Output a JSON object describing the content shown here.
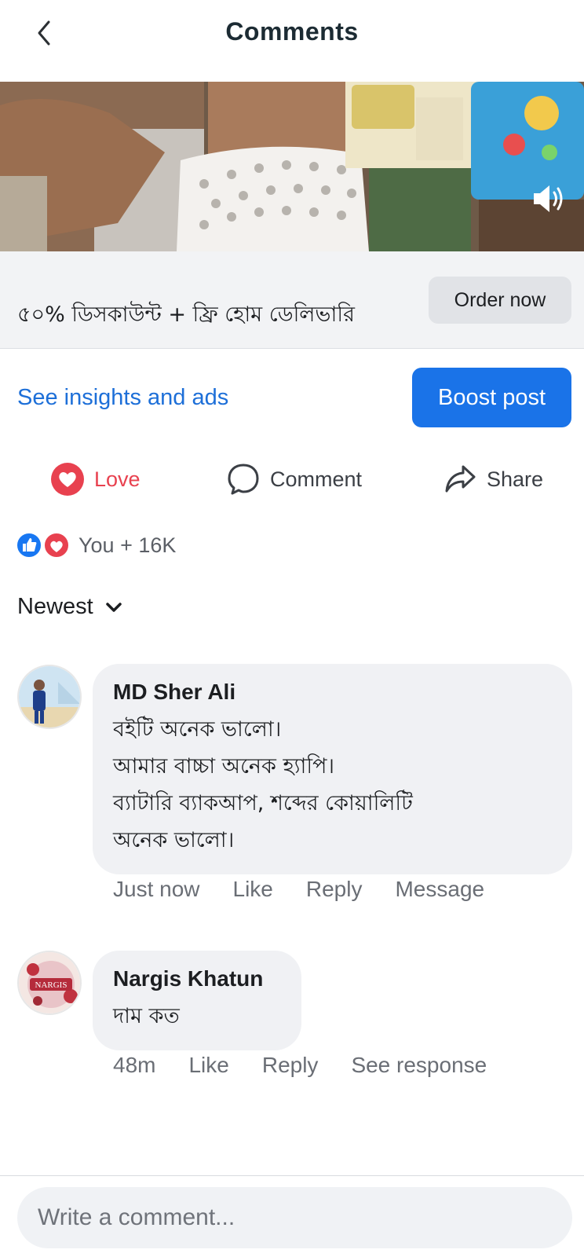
{
  "header": {
    "title": "Comments",
    "back_icon": "chevron-left-icon"
  },
  "video": {
    "sound_icon": "speaker-icon"
  },
  "ad": {
    "text": "৫০% ডিসকাউন্ট + ফ্রি হোম ডেলিভারি",
    "cta_label": "Order now"
  },
  "insights": {
    "link_label": "See insights and ads",
    "boost_label": "Boost post"
  },
  "actions": {
    "love": "Love",
    "comment": "Comment",
    "share": "Share"
  },
  "reactions": {
    "summary": "You + 16K",
    "icons": [
      "like-icon",
      "love-icon"
    ]
  },
  "sort": {
    "label": "Newest"
  },
  "comments": [
    {
      "author": "MD Sher Ali",
      "lines": [
        "বইটি অনেক ভালো।",
        "আমার বাচ্চা অনেক হ্যাপি।",
        "ব্যাটারি ব্যাকআপ, শব্দের কোয়ালিটি",
        "অনেক ভালো।"
      ],
      "time": "Just now",
      "like": "Like",
      "reply": "Reply",
      "extra": "Message"
    },
    {
      "author": "Nargis Khatun",
      "lines": [
        "দাম কত"
      ],
      "time": "48m",
      "like": "Like",
      "reply": "Reply",
      "extra": "See response",
      "avatar_text": "NARGIS"
    }
  ],
  "composer": {
    "placeholder": "Write a comment..."
  },
  "colors": {
    "accent": "#1a73e8",
    "link": "#1d6fd8",
    "love": "#e8414f",
    "bubble": "#f0f1f4"
  }
}
